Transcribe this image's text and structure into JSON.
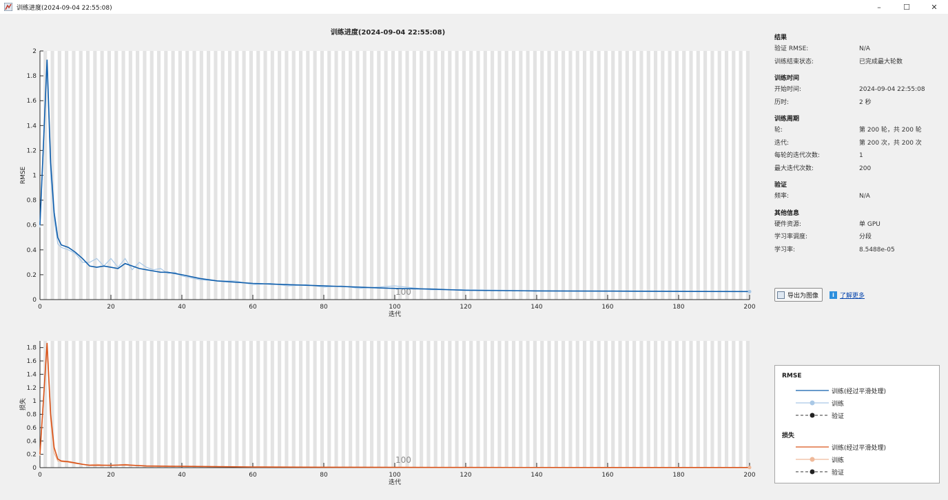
{
  "window": {
    "title": "训练进度(2024-09-04 22:55:08)",
    "controls": {
      "minimize": "–",
      "maximize": "☐",
      "close": "✕"
    }
  },
  "plot_title": "训练进度(2024-09-04 22:55:08)",
  "info": {
    "results": {
      "title": "结果",
      "rows": [
        {
          "key": "验证 RMSE:",
          "value": "N/A"
        },
        {
          "key": "训练结束状态:",
          "value": "已完成最大轮数"
        }
      ]
    },
    "time": {
      "title": "训练时间",
      "rows": [
        {
          "key": "开始时间:",
          "value": "2024-09-04 22:55:08"
        },
        {
          "key": "历时:",
          "value": "2 秒"
        }
      ]
    },
    "cycle": {
      "title": "训练周期",
      "rows": [
        {
          "key": "轮:",
          "value": "第 200 轮，共 200 轮"
        },
        {
          "key": "迭代:",
          "value": "第 200 次，共 200 次"
        },
        {
          "key": "每轮的迭代次数:",
          "value": "1"
        },
        {
          "key": "最大迭代次数:",
          "value": "200"
        }
      ]
    },
    "validation": {
      "title": "验证",
      "rows": [
        {
          "key": "频率:",
          "value": "N/A"
        }
      ]
    },
    "other": {
      "title": "其他信息",
      "rows": [
        {
          "key": "硬件资源:",
          "value": "单 GPU"
        },
        {
          "key": "学习率调度:",
          "value": "分段"
        },
        {
          "key": "学习率:",
          "value": "8.5488e-05"
        }
      ]
    }
  },
  "buttons": {
    "export": "导出为图像",
    "learn_more": "了解更多"
  },
  "legend": {
    "rmse_title": "RMSE",
    "loss_title": "损失",
    "smoothed": "训练(经过平滑处理)",
    "training": "训练",
    "validation": "验证"
  },
  "colors": {
    "rmse_smoothed": "#0f5eac",
    "rmse_raw": "#a9c8e6",
    "loss_smoothed": "#d95319",
    "loss_raw": "#efb99a",
    "validation": "#333333",
    "stripe": "#e3e3e3"
  },
  "chart_data": [
    {
      "type": "line",
      "ylabel": "RMSE",
      "xlabel": "迭代",
      "xlim": [
        0,
        200
      ],
      "ylim": [
        0,
        2
      ],
      "x_ticks": [
        0,
        20,
        40,
        60,
        80,
        100,
        120,
        140,
        160,
        180,
        200
      ],
      "y_ticks": [
        0,
        0.2,
        0.4,
        0.6,
        0.8,
        1,
        1.2,
        1.4,
        1.6,
        1.8,
        2
      ],
      "y_tick_labels": [
        "0",
        "0.2",
        "0.4",
        "0.6",
        "0.8",
        "1",
        "1.2",
        "1.4",
        "1.6",
        "1.8",
        "2"
      ],
      "annotation": {
        "text": "100",
        "x": 100
      },
      "series": [
        {
          "name": "训练(经过平滑处理)",
          "x": [
            0,
            2,
            3,
            4,
            5,
            6,
            8,
            10,
            12,
            14,
            16,
            18,
            20,
            22,
            24,
            26,
            28,
            30,
            32,
            34,
            36,
            38,
            40,
            45,
            50,
            55,
            60,
            65,
            70,
            75,
            80,
            85,
            90,
            95,
            100,
            110,
            120,
            140,
            160,
            180,
            200
          ],
          "y": [
            0.6,
            1.93,
            1.1,
            0.7,
            0.5,
            0.44,
            0.42,
            0.38,
            0.33,
            0.27,
            0.26,
            0.27,
            0.26,
            0.25,
            0.29,
            0.27,
            0.25,
            0.24,
            0.23,
            0.22,
            0.22,
            0.21,
            0.2,
            0.17,
            0.15,
            0.14,
            0.13,
            0.125,
            0.12,
            0.115,
            0.11,
            0.105,
            0.1,
            0.095,
            0.09,
            0.085,
            0.075,
            0.07,
            0.068,
            0.066,
            0.065
          ]
        },
        {
          "name": "训练",
          "x": [
            0,
            2,
            3,
            4,
            5,
            6,
            8,
            10,
            12,
            14,
            16,
            18,
            20,
            22,
            24,
            26,
            28,
            30,
            32,
            34,
            36,
            38,
            40,
            45,
            50,
            55,
            60,
            65,
            70,
            75,
            80,
            85,
            90,
            95,
            100,
            110,
            120,
            140,
            160,
            180,
            200
          ],
          "y": [
            0.58,
            1.9,
            1.0,
            0.65,
            0.45,
            0.42,
            0.4,
            0.37,
            0.3,
            0.3,
            0.33,
            0.27,
            0.33,
            0.26,
            0.33,
            0.24,
            0.3,
            0.26,
            0.24,
            0.25,
            0.21,
            0.22,
            0.19,
            0.16,
            0.15,
            0.15,
            0.12,
            0.13,
            0.11,
            0.12,
            0.1,
            0.11,
            0.09,
            0.1,
            0.11,
            0.08,
            0.08,
            0.07,
            0.067,
            0.065,
            0.064
          ]
        }
      ]
    },
    {
      "type": "line",
      "ylabel": "损失",
      "xlabel": "迭代",
      "xlim": [
        0,
        200
      ],
      "ylim": [
        0,
        1.9
      ],
      "x_ticks": [
        0,
        20,
        40,
        60,
        80,
        100,
        120,
        140,
        160,
        180,
        200
      ],
      "y_ticks": [
        0,
        0.2,
        0.4,
        0.6,
        0.8,
        1,
        1.2,
        1.4,
        1.6,
        1.8
      ],
      "y_tick_labels": [
        "0",
        "0.2",
        "0.4",
        "0.6",
        "0.8",
        "1",
        "1.2",
        "1.4",
        "1.6",
        "1.8"
      ],
      "annotation": {
        "text": "100",
        "x": 100
      },
      "series": [
        {
          "name": "训练(经过平滑处理)",
          "x": [
            0,
            2,
            3,
            4,
            5,
            6,
            8,
            10,
            12,
            14,
            16,
            20,
            24,
            30,
            40,
            60,
            80,
            100,
            120,
            160,
            200
          ],
          "y": [
            0.2,
            1.87,
            0.8,
            0.3,
            0.13,
            0.1,
            0.09,
            0.07,
            0.05,
            0.035,
            0.035,
            0.035,
            0.04,
            0.025,
            0.02,
            0.01,
            0.006,
            0.004,
            0.003,
            0.002,
            0.002
          ]
        },
        {
          "name": "训练",
          "x": [
            0,
            2,
            3,
            4,
            5,
            6,
            8,
            10,
            12,
            14,
            16,
            20,
            24,
            30,
            40,
            60,
            80,
            100,
            120,
            160,
            200
          ],
          "y": [
            0.18,
            1.82,
            0.7,
            0.22,
            0.1,
            0.09,
            0.08,
            0.06,
            0.05,
            0.04,
            0.05,
            0.03,
            0.05,
            0.02,
            0.02,
            0.008,
            0.006,
            0.004,
            0.003,
            0.002,
            0.002
          ]
        }
      ]
    }
  ]
}
